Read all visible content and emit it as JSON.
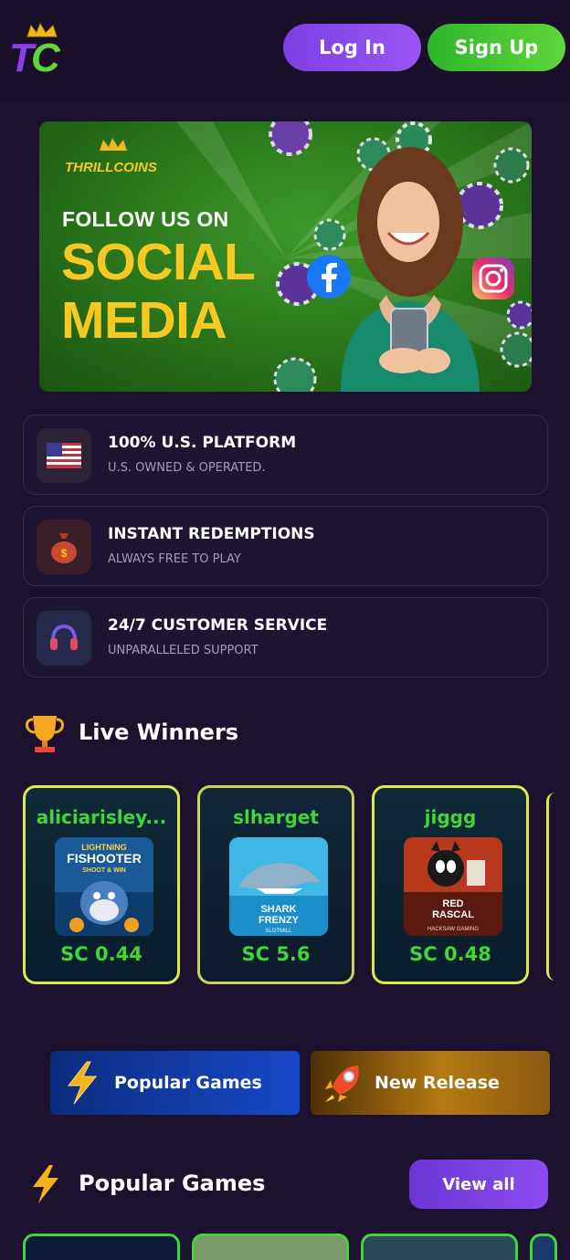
{
  "header": {
    "logo_text": "TC",
    "login_label": "Log In",
    "signup_label": "Sign Up"
  },
  "banner": {
    "brand": "THRILL",
    "brand_coins": "COINS",
    "line1": "FOLLOW US ON",
    "line2": "SOCIAL",
    "line3": "MEDIA"
  },
  "features": [
    {
      "icon": "us-flag-icon",
      "title": "100% U.S. PLATFORM",
      "subtitle": "U.S. OWNED & OPERATED."
    },
    {
      "icon": "money-bag-icon",
      "title": "INSTANT REDEMPTIONS",
      "subtitle": "ALWAYS FREE TO PLAY"
    },
    {
      "icon": "headset-icon",
      "title": "24/7 CUSTOMER SERVICE",
      "subtitle": "UNPARALLELED SUPPORT"
    }
  ],
  "live_winners": {
    "title": "Live Winners",
    "items": [
      {
        "name": "aliciarisley...",
        "game": "LIGHTNING FISHOOTER SHOOT & WIN",
        "amount": "SC 0.44"
      },
      {
        "name": "slharget",
        "game": "SHARK FRENZY",
        "provider": "SLOTMILL",
        "amount": "SC 5.6"
      },
      {
        "name": "jiggg",
        "game": "RED RASCAL",
        "provider": "HACKSAW GAMING",
        "amount": "SC 0.48"
      }
    ]
  },
  "categories": [
    {
      "label": "Popular Games",
      "icon": "lightning-icon"
    },
    {
      "label": "New Release",
      "icon": "rocket-icon"
    }
  ],
  "popular_games": {
    "title": "Popular Games",
    "view_all_label": "View all"
  },
  "colors": {
    "background": "#1c1230",
    "accent_purple": "#7b3fe4",
    "accent_green": "#41d637",
    "banner_yellow": "#f5c922"
  }
}
